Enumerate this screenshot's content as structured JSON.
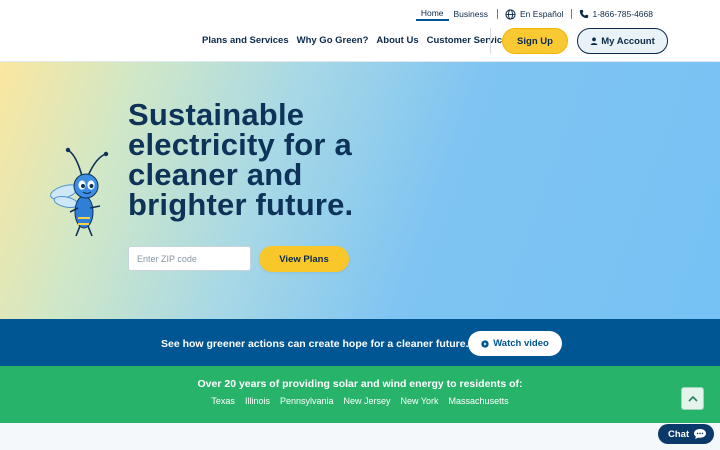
{
  "header": {
    "utility": {
      "home": "Home",
      "business": "Business",
      "language": "En Español",
      "phone": "1-866-785-4668",
      "globe_icon": "globe-icon",
      "phone_icon": "phone-icon"
    },
    "nav": [
      {
        "label": "Plans and Services"
      },
      {
        "label": "Why Go Green?"
      },
      {
        "label": "About Us"
      },
      {
        "label": "Customer Service"
      }
    ],
    "sign_up": "Sign Up",
    "my_account": "My Account"
  },
  "hero": {
    "title": "Sustainable electricity for a cleaner and brighter future.",
    "zip_placeholder": "Enter ZIP code",
    "zip_value": "",
    "view_plans": "View Plans",
    "mascot_icon": "firefly-mascot-icon"
  },
  "banner": {
    "text": "See how greener actions can create hope for a cleaner future.",
    "watch_video": "Watch video"
  },
  "coverage": {
    "title": "Over 20 years of providing solar and wind energy to residents of:",
    "states": [
      "Texas",
      "Illinois",
      "Pennsylvania",
      "New Jersey",
      "New York",
      "Massachusetts"
    ]
  },
  "chat": {
    "label": "Chat"
  },
  "colors": {
    "navy": "#0b2a4a",
    "brand_blue": "#005593",
    "brand_green": "#27b36a",
    "accent_yellow": "#fac72b"
  }
}
